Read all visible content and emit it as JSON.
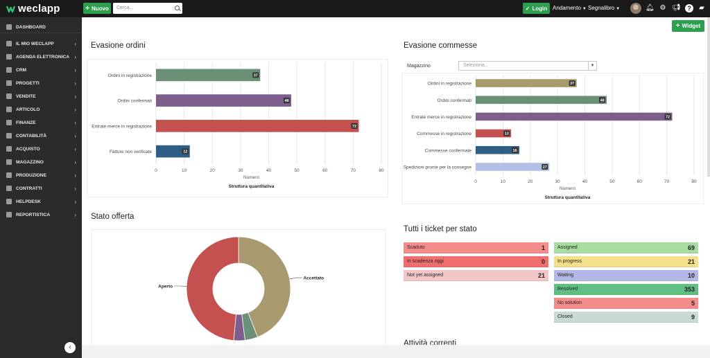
{
  "app": {
    "logo": "weclapp"
  },
  "topbar": {
    "new_label": "Nuovo",
    "search_placeholder": "Cerca...",
    "login_label": "Login",
    "menu_andamento": "Andamento",
    "menu_segnalibro": "Segnalibro"
  },
  "sidebar": {
    "items": [
      {
        "label": "DASHBOARD",
        "icon": "dashboard-icon"
      },
      {
        "label": "IL MIO WECLAPP",
        "icon": "home-icon"
      },
      {
        "label": "AGENDA ELETTRONICA",
        "icon": "calendar-icon"
      },
      {
        "label": "CRM",
        "icon": "crm-icon"
      },
      {
        "label": "PROGETTI",
        "icon": "projects-icon"
      },
      {
        "label": "VENDITE",
        "icon": "sales-icon"
      },
      {
        "label": "ARTICOLO",
        "icon": "article-icon"
      },
      {
        "label": "FINANZE",
        "icon": "finance-icon"
      },
      {
        "label": "CONTABILITÀ",
        "icon": "accounting-icon"
      },
      {
        "label": "ACQUISTO",
        "icon": "purchase-icon"
      },
      {
        "label": "MAGAZZINO",
        "icon": "warehouse-icon"
      },
      {
        "label": "PRODUZIONE",
        "icon": "production-icon"
      },
      {
        "label": "CONTRATTI",
        "icon": "contracts-icon"
      },
      {
        "label": "HELPDESK",
        "icon": "helpdesk-icon"
      },
      {
        "label": "REPORTISTICA",
        "icon": "reports-icon"
      }
    ]
  },
  "main": {
    "widget_label": "Widget",
    "panels": {
      "ordini_title": "Evasione ordini",
      "commesse_title": "Evasione commesse",
      "magazzino_label": "Magazzino",
      "magazzino_placeholder": "Seleziona...",
      "offerta_title": "Stato offerta",
      "ticket_title": "Tutti i ticket per stato",
      "attivita_title": "Attività correnti"
    }
  },
  "chart_data": [
    {
      "type": "bar",
      "orientation": "horizontal",
      "title": "Evasione ordini",
      "categories": [
        "Ordini in registrazione",
        "Ordini confermati",
        "Entrate merce in registrazione",
        "Fatture non verificate"
      ],
      "values": [
        37,
        48,
        72,
        12
      ],
      "colors": [
        "#6b8f77",
        "#7d5e8c",
        "#c4504f",
        "#2e5d86"
      ],
      "xlabel": "Numero",
      "caption": "Struttura quantitativa",
      "xlim": [
        0,
        80
      ],
      "xticks": [
        0,
        10,
        20,
        30,
        40,
        50,
        60,
        70,
        80
      ],
      "grid": true
    },
    {
      "type": "bar",
      "orientation": "horizontal",
      "title": "Evasione commesse",
      "categories": [
        "Ordini in registrazione",
        "Ordini confermati",
        "Entrate merce in registrazione",
        "Commesse in registrazione",
        "Commesse confermate",
        "Spedizioni pronte per la consegne"
      ],
      "values": [
        37,
        48,
        72,
        13,
        16,
        27
      ],
      "colors": [
        "#a89a6e",
        "#6b8f77",
        "#7d5e8c",
        "#c4504f",
        "#2e5d86",
        "#b3c0e6"
      ],
      "xlabel": "Numero",
      "caption": "Struttura quantitativa",
      "xlim": [
        0,
        80
      ],
      "xticks": [
        0,
        10,
        20,
        30,
        40,
        50,
        60,
        70,
        80
      ],
      "grid": true
    },
    {
      "type": "pie",
      "title": "Stato offerta",
      "donut": true,
      "slices": [
        {
          "label": "Accettato",
          "fraction": 0.44,
          "color": "#a89a6e"
        },
        {
          "label": "",
          "fraction": 0.04,
          "color": "#6b8f77"
        },
        {
          "label": "",
          "fraction": 0.035,
          "color": "#7d5e8c"
        },
        {
          "label": "Aperto",
          "fraction": 0.485,
          "color": "#c4504f"
        }
      ]
    }
  ],
  "tickets": {
    "left": [
      {
        "label": "Scaduto",
        "value": "1",
        "color": "#f58c8c"
      },
      {
        "label": "In scadenza oggi",
        "value": "0",
        "color": "#f06e6e"
      },
      {
        "label": "Not yet assigned",
        "value": "21",
        "color": "#f2c6c6"
      }
    ],
    "right": [
      {
        "label": "Assigned",
        "value": "69",
        "color": "#a8dca0"
      },
      {
        "label": "In progress",
        "value": "21",
        "color": "#f4e08a"
      },
      {
        "label": "Waiting",
        "value": "10",
        "color": "#b3b8e6"
      },
      {
        "label": "Resolved",
        "value": "353",
        "color": "#5fbf82"
      },
      {
        "label": "No solution",
        "value": "5",
        "color": "#f58c8c"
      },
      {
        "label": "Closed",
        "value": "9",
        "color": "#c9d9d6"
      }
    ]
  }
}
